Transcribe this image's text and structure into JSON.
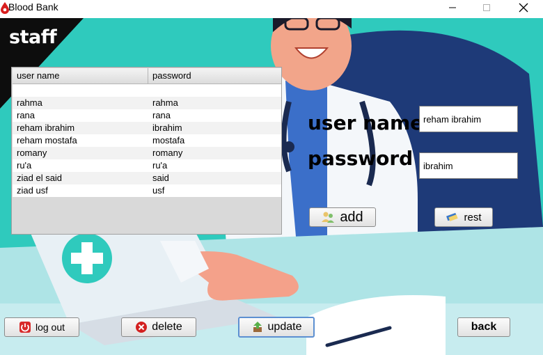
{
  "window": {
    "title": "Blood Bank"
  },
  "header": {
    "title": "staff"
  },
  "table": {
    "columns": [
      "user name",
      "password"
    ],
    "rows": [
      [
        "",
        ""
      ],
      [
        "rahma",
        "rahma"
      ],
      [
        "rana",
        "rana"
      ],
      [
        "reham ibrahim",
        "ibrahim"
      ],
      [
        "reham mostafa",
        "mostafa"
      ],
      [
        "romany",
        "romany"
      ],
      [
        "ru'a",
        "ru'a"
      ],
      [
        "ziad el said",
        "said"
      ],
      [
        "ziad usf",
        "usf"
      ]
    ]
  },
  "form": {
    "username_label": "user name",
    "username_value": "reham ibrahim",
    "password_label": "password",
    "password_value": "ibrahim"
  },
  "buttons": {
    "add": "add",
    "rest": "rest",
    "logout": "log out",
    "delete": "delete",
    "update": "update",
    "back": "back"
  },
  "colors": {
    "accent": "#2ec9bd",
    "focus": "#5c8fd1"
  }
}
